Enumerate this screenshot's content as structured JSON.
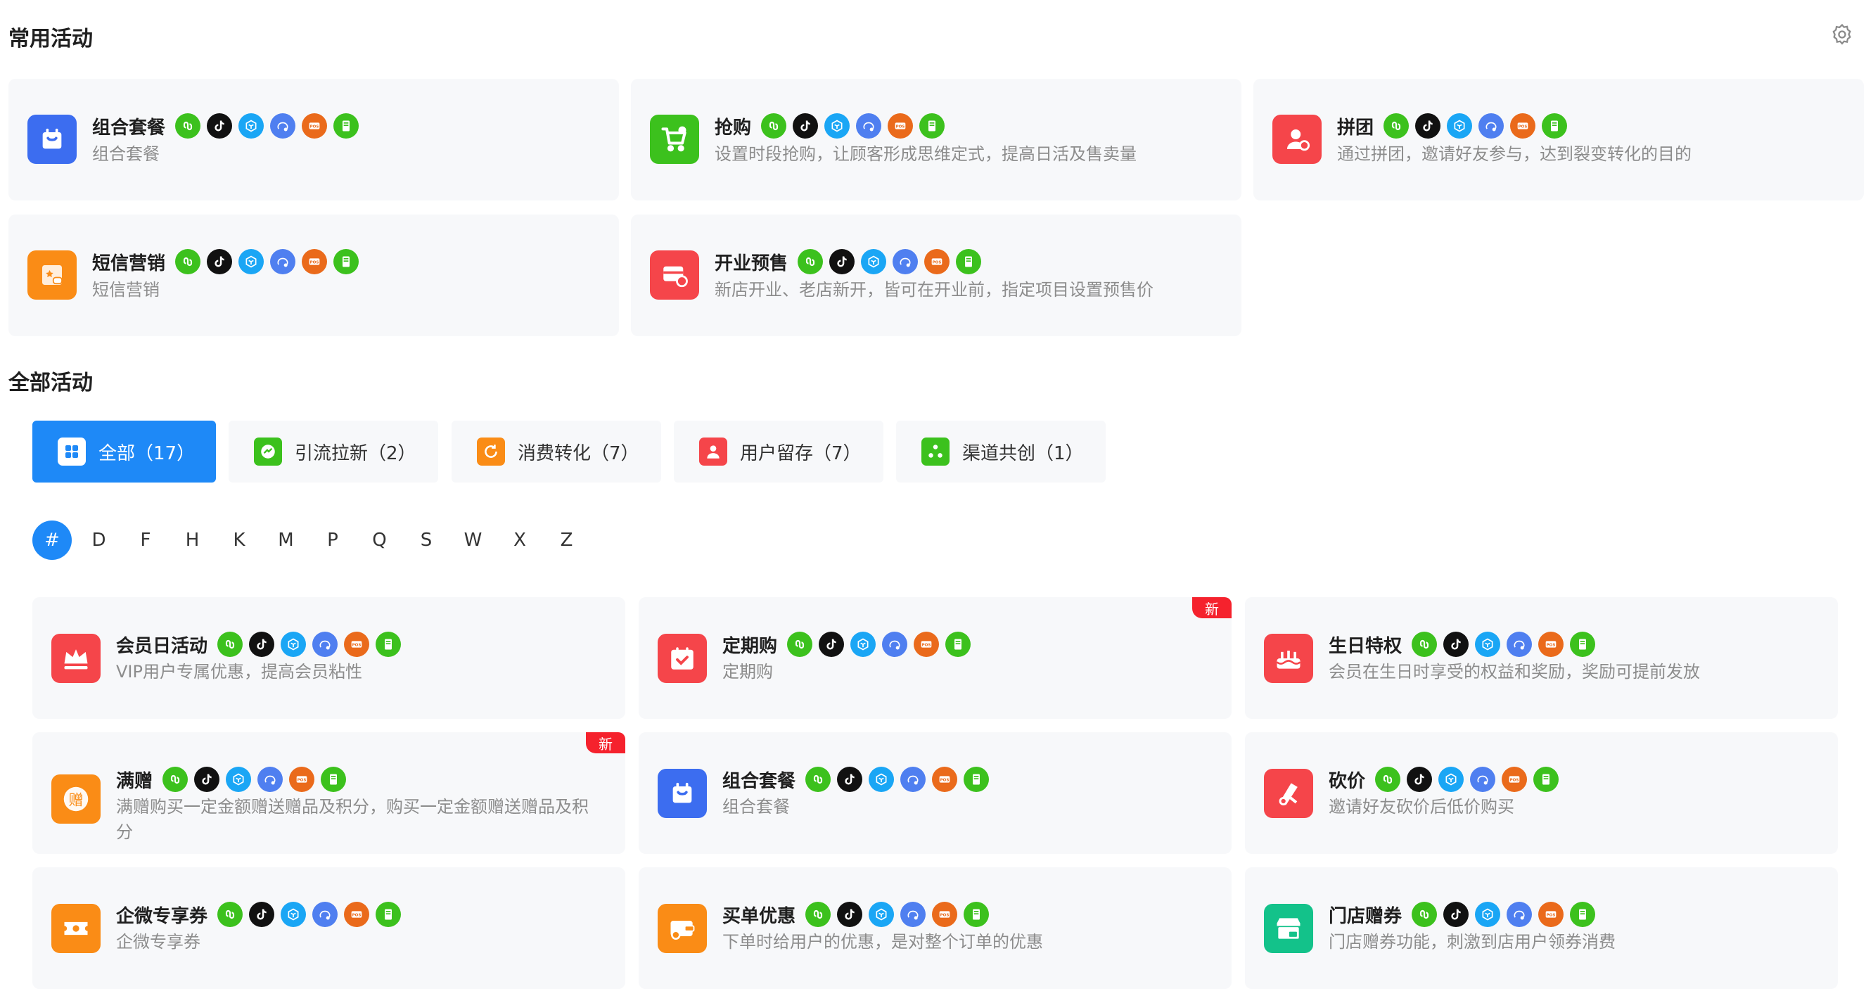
{
  "common_section": {
    "title": "常用活动"
  },
  "all_section": {
    "title": "全部活动"
  },
  "platform_icons": [
    "mini-program-icon",
    "douyin-icon",
    "app-icon",
    "wecom-icon",
    "pos-icon",
    "h5-icon"
  ],
  "common_cards": [
    {
      "name": "combo-package",
      "title": "组合套餐",
      "desc": "组合套餐",
      "color": "#3c6df0",
      "icon": "bag-icon"
    },
    {
      "name": "flash-sale",
      "title": "抢购",
      "desc": "设置时段抢购，让顾客形成思维定式，提高日活及售卖量",
      "color": "#3cc11d",
      "icon": "cart-icon"
    },
    {
      "name": "group-buy",
      "title": "拼团",
      "desc": "通过拼团，邀请好友参与，达到裂变转化的目的",
      "color": "#f5454a",
      "icon": "group-icon"
    },
    {
      "name": "sms-marketing",
      "title": "短信营销",
      "desc": "短信营销",
      "color": "#fa8c16",
      "icon": "sms-icon"
    },
    {
      "name": "opening-presale",
      "title": "开业预售",
      "desc": "新店开业、老店新开，皆可在开业前，指定项目设置预售价",
      "color": "#f5454a",
      "icon": "store-clock-icon"
    }
  ],
  "tabs": [
    {
      "label": "全部（17）",
      "color": "#ffffff",
      "icon": "grid-icon"
    },
    {
      "label": "引流拉新（2）",
      "color": "#3cc11d",
      "icon": "traffic-icon"
    },
    {
      "label": "消费转化（7）",
      "color": "#fa8c16",
      "icon": "conversion-icon"
    },
    {
      "label": "用户留存（7）",
      "color": "#f5454a",
      "icon": "user-icon"
    },
    {
      "label": "渠道共创（1）",
      "color": "#3cc11d",
      "icon": "channel-icon"
    }
  ],
  "letters": [
    "#",
    "D",
    "F",
    "H",
    "K",
    "M",
    "P",
    "Q",
    "S",
    "W",
    "X",
    "Z"
  ],
  "new_badge": "新",
  "all_cards": [
    {
      "name": "member-day",
      "title": "会员日活动",
      "desc": "VIP用户专属优惠，提高会员粘性",
      "color": "#f5454a",
      "icon": "crown-icon",
      "is_new": false
    },
    {
      "name": "subscription",
      "title": "定期购",
      "desc": "定期购",
      "color": "#f5454a",
      "icon": "calendar-icon",
      "is_new": true
    },
    {
      "name": "birthday-privilege",
      "title": "生日特权",
      "desc": "会员在生日时享受的权益和奖励，奖励可提前发放",
      "color": "#f5454a",
      "icon": "cake-icon",
      "is_new": false
    },
    {
      "name": "gift-with-purchase",
      "title": "满赠",
      "desc": "满赠购买一定金额赠送赠品及积分，购买一定金额赠送赠品及积分",
      "color": "#fa8c16",
      "icon": "gift-icon",
      "glyph": "赠",
      "is_new": true
    },
    {
      "name": "combo-package-2",
      "title": "组合套餐",
      "desc": "组合套餐",
      "color": "#3c6df0",
      "icon": "bag-icon",
      "is_new": false
    },
    {
      "name": "bargain",
      "title": "砍价",
      "desc": "邀请好友砍价后低价购买",
      "color": "#f5454a",
      "icon": "bargain-icon",
      "is_new": false
    },
    {
      "name": "wecom-coupon",
      "title": "企微专享券",
      "desc": "企微专享券",
      "color": "#fa8c16",
      "icon": "coupon-icon",
      "is_new": false
    },
    {
      "name": "checkout-discount",
      "title": "买单优惠",
      "desc": "下单时给用户的优惠，是对整个订单的优惠",
      "color": "#fa8c16",
      "icon": "wallet-icon",
      "is_new": false
    },
    {
      "name": "store-coupon-gift",
      "title": "门店赠券",
      "desc": "门店赠券功能，刺激到店用户领券消费",
      "color": "#13c28a",
      "icon": "store-coupon-icon",
      "is_new": false
    }
  ]
}
